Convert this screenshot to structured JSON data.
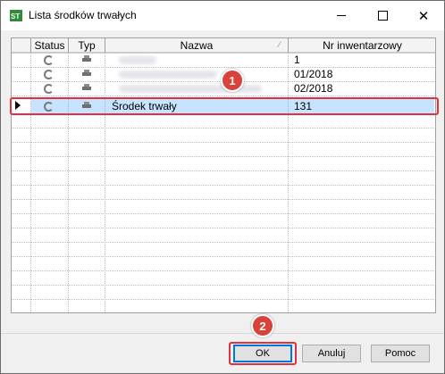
{
  "window": {
    "title": "Lista środków trwałych",
    "app_icon": "st-icon",
    "controls": {
      "minimize": "minimize-icon",
      "maximize": "maximize-icon",
      "close_glyph": "✕"
    }
  },
  "table": {
    "columns": [
      "Status",
      "Typ",
      "Nazwa",
      "Nr inwentarzowy"
    ],
    "rows": [
      {
        "status_icon": "refresh-icon",
        "type_icon": "printer-icon",
        "nazwa": "",
        "nr": "1"
      },
      {
        "status_icon": "refresh-icon",
        "type_icon": "printer-icon",
        "nazwa": "",
        "nr": "01/2018"
      },
      {
        "status_icon": "refresh-icon",
        "type_icon": "printer-icon",
        "nazwa": "",
        "nr": "02/2018"
      },
      {
        "status_icon": "refresh-icon",
        "type_icon": "printer-icon",
        "nazwa": "Środek trwały",
        "nr": "131",
        "selected": true
      }
    ]
  },
  "annotations": {
    "badge1": "1",
    "badge2": "2",
    "highlight_color": "#e0313e"
  },
  "buttons": {
    "ok": "OK",
    "cancel": "Anuluj",
    "help": "Pomoc"
  }
}
